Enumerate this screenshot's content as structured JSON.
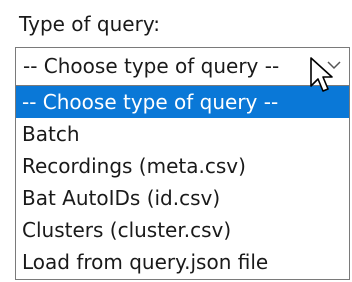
{
  "field_label": "Type of query:",
  "select": {
    "current_value": "-- Choose type of query --",
    "chevron_icon": "chevron-down-icon"
  },
  "options": [
    {
      "label": "-- Choose type of query --",
      "highlighted": true
    },
    {
      "label": "Batch",
      "highlighted": false
    },
    {
      "label": "Recordings (meta.csv)",
      "highlighted": false
    },
    {
      "label": "Bat AutoIDs (id.csv)",
      "highlighted": false
    },
    {
      "label": "Clusters (cluster.csv)",
      "highlighted": false
    },
    {
      "label": "Load from query.json file",
      "highlighted": false
    }
  ],
  "colors": {
    "highlight": "#0a78d7",
    "border": "#7a7a7a",
    "text": "#1a1a1a"
  },
  "cursor_icon": "arrow-pointer-icon"
}
